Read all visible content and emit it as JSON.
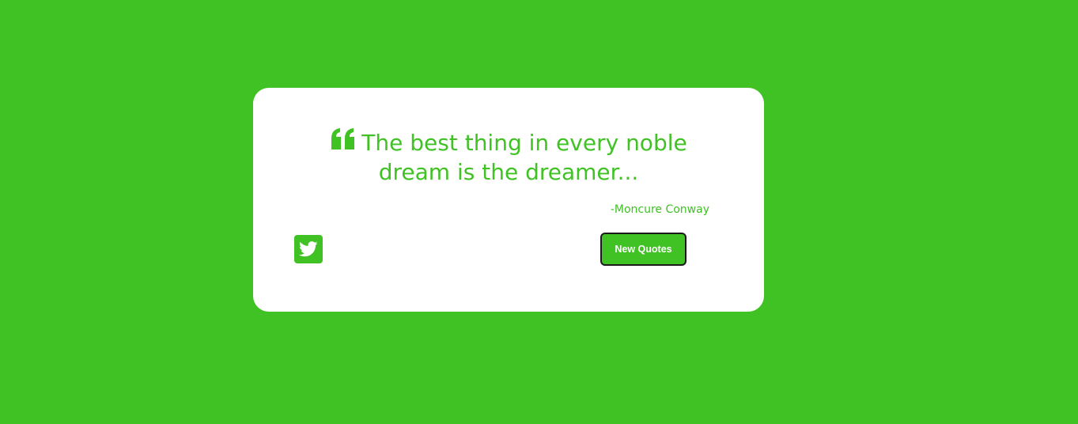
{
  "colors": {
    "background": "#40c224",
    "card": "#ffffff",
    "accent": "#40c224"
  },
  "quote": {
    "icon": "quote-left-icon",
    "text": "The best thing in every noble dream is the dreamer...",
    "author": "-Moncure Conway"
  },
  "actions": {
    "tweet_icon": "twitter-icon",
    "new_quote_label": "New Quotes"
  }
}
